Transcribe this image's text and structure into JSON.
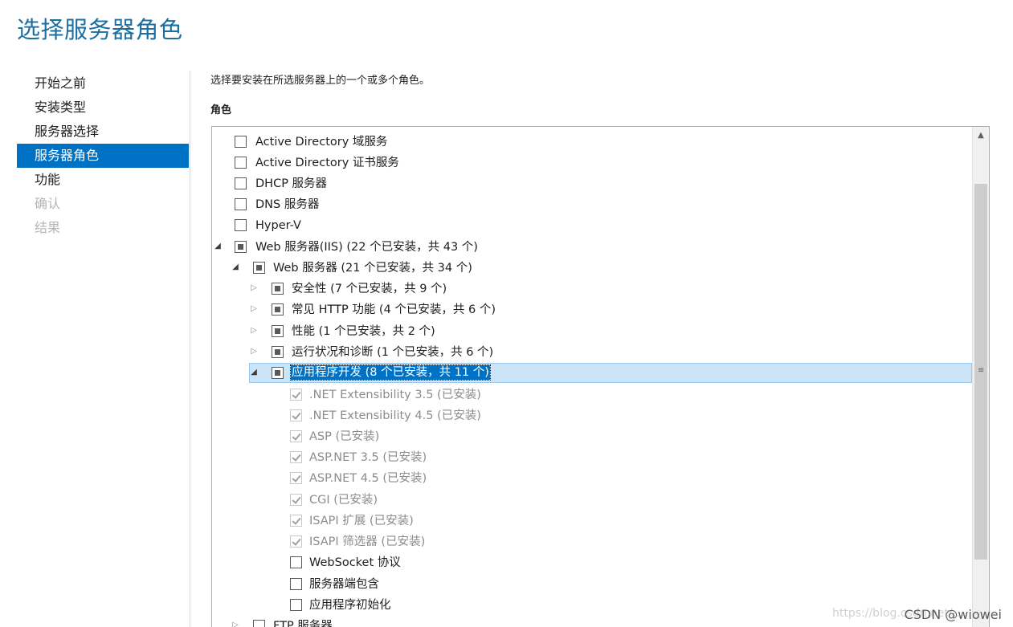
{
  "page_title": "选择服务器角色",
  "nav": {
    "items": [
      {
        "label": "开始之前",
        "state": "normal"
      },
      {
        "label": "安装类型",
        "state": "normal"
      },
      {
        "label": "服务器选择",
        "state": "normal"
      },
      {
        "label": "服务器角色",
        "state": "active"
      },
      {
        "label": "功能",
        "state": "normal"
      },
      {
        "label": "确认",
        "state": "disabled"
      },
      {
        "label": "结果",
        "state": "disabled"
      }
    ]
  },
  "main": {
    "description": "选择要安装在所选服务器上的一个或多个角色。",
    "roles_heading": "角色",
    "roles": [
      {
        "label": "Active Directory 域服务",
        "state": "unchecked"
      },
      {
        "label": "Active Directory 证书服务",
        "state": "unchecked"
      },
      {
        "label": "DHCP 服务器",
        "state": "unchecked"
      },
      {
        "label": "DNS 服务器",
        "state": "unchecked"
      },
      {
        "label": "Hyper-V",
        "state": "unchecked"
      },
      {
        "label": "Web 服务器(IIS) (22 个已安装，共 43 个)",
        "state": "partial"
      },
      {
        "label": "Web 服务器 (21 个已安装，共 34 个)",
        "state": "partial"
      },
      {
        "label": "安全性 (7 个已安装，共 9 个)",
        "state": "partial"
      },
      {
        "label": "常见 HTTP 功能 (4 个已安装，共 6 个)",
        "state": "partial"
      },
      {
        "label": "性能 (1 个已安装，共 2 个)",
        "state": "partial"
      },
      {
        "label": "运行状况和诊断 (1 个已安装，共 6 个)",
        "state": "partial"
      },
      {
        "label": "应用程序开发 (8 个已安装，共 11 个)",
        "state": "partial"
      },
      {
        "label": ".NET Extensibility 3.5 (已安装)",
        "state": "installed"
      },
      {
        "label": ".NET Extensibility 4.5 (已安装)",
        "state": "installed"
      },
      {
        "label": "ASP (已安装)",
        "state": "installed"
      },
      {
        "label": "ASP.NET 3.5 (已安装)",
        "state": "installed"
      },
      {
        "label": "ASP.NET 4.5 (已安装)",
        "state": "installed"
      },
      {
        "label": "CGI (已安装)",
        "state": "installed"
      },
      {
        "label": "ISAPI 扩展 (已安装)",
        "state": "installed"
      },
      {
        "label": "ISAPI 筛选器 (已安装)",
        "state": "installed"
      },
      {
        "label": "WebSocket 协议",
        "state": "unchecked"
      },
      {
        "label": "服务器端包含",
        "state": "unchecked"
      },
      {
        "label": "应用程序初始化",
        "state": "unchecked"
      },
      {
        "label": "FTP 服务器",
        "state": "unchecked"
      }
    ]
  },
  "watermark": "CSDN @wiowei",
  "watermark_faint": "https://blog.csdn.net/..."
}
